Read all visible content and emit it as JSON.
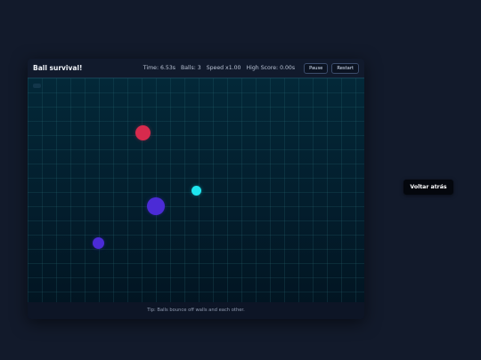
{
  "game": {
    "title": "Ball survival!",
    "stats": {
      "time": "Time: 6.53s",
      "balls": "Balls: 3",
      "speed": "Speed x1.00",
      "high_score": "High Score: 0.00s"
    },
    "buttons": {
      "pause": "Pause",
      "restart": "Restart"
    },
    "tip": "Tip: Balls bounce off walls and each other.",
    "balls": [
      {
        "color": "#d72a4d"
      },
      {
        "color": "#1ee6f0"
      },
      {
        "color": "#4b2bd6"
      },
      {
        "color": "#4b2bd6"
      }
    ]
  },
  "back_button": {
    "label": "Voltar atrás"
  }
}
